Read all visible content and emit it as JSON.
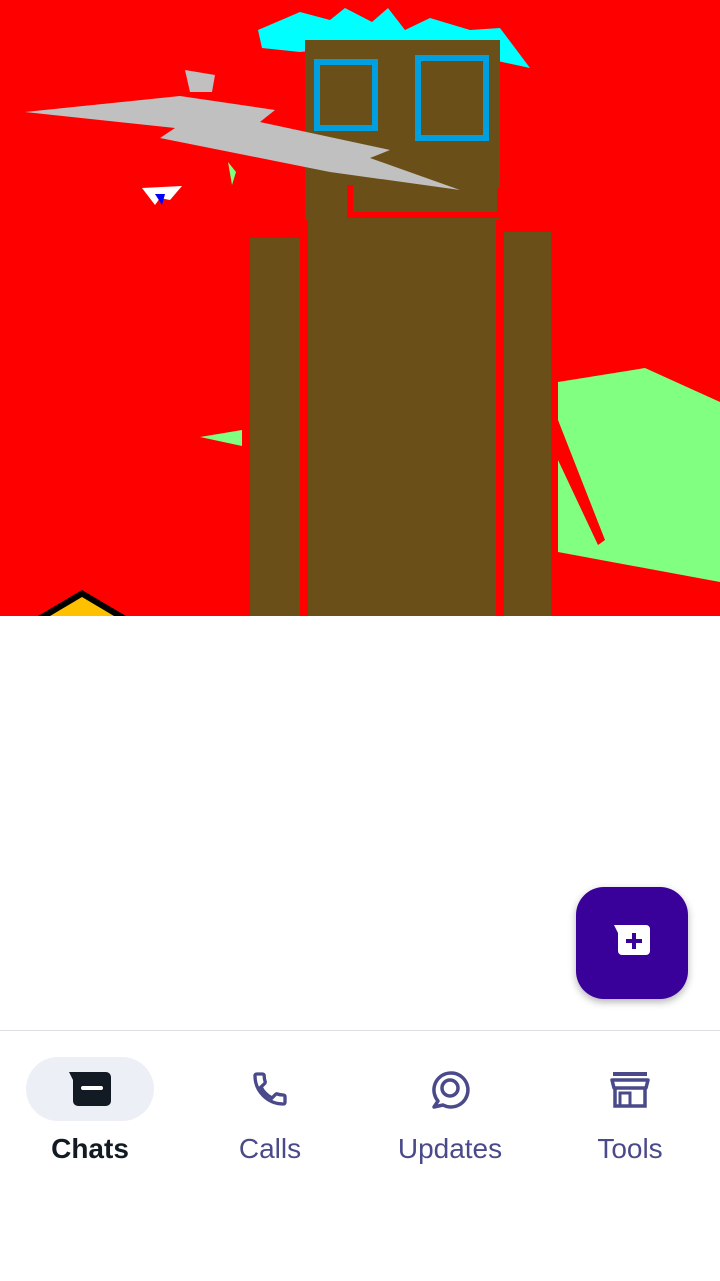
{
  "nav": {
    "items": [
      {
        "label": "Chats",
        "icon": "chat-icon",
        "active": true
      },
      {
        "label": "Calls",
        "icon": "phone-icon",
        "active": false
      },
      {
        "label": "Updates",
        "icon": "updates-icon",
        "active": false
      },
      {
        "label": "Tools",
        "icon": "store-icon",
        "active": false
      }
    ]
  },
  "fab": {
    "icon": "new-chat-icon"
  },
  "colors": {
    "accent": "#39009a",
    "nav_inactive": "#4a4a8a",
    "nav_active": "#121a24",
    "nav_active_pill": "#eceff5",
    "artwork_background": "#ff0000"
  }
}
